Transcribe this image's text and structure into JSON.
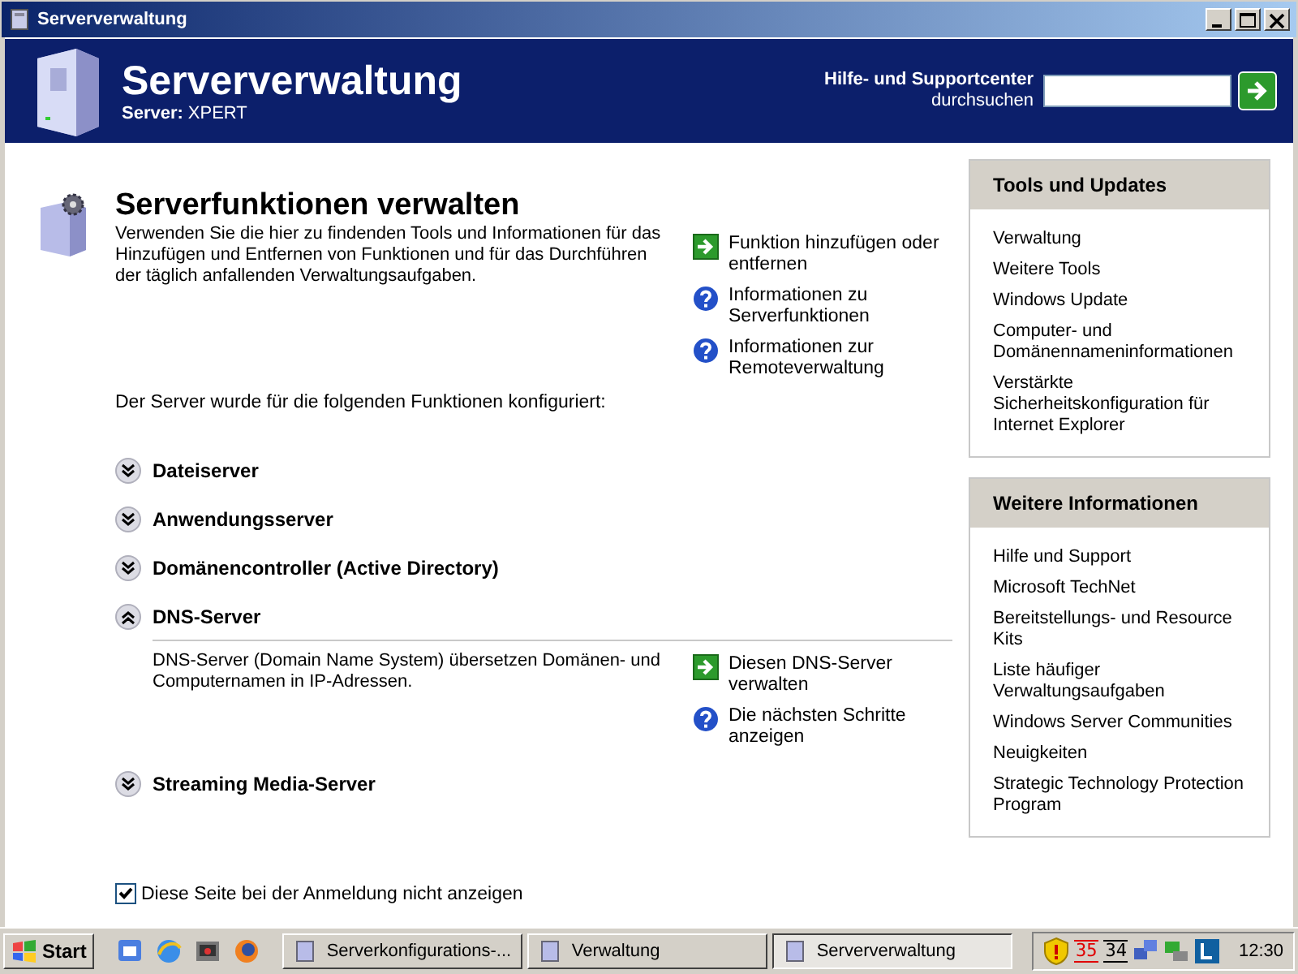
{
  "window": {
    "title": "Serververwaltung"
  },
  "header": {
    "title": "Serververwaltung",
    "server_label": "Server:",
    "server_name": "XPERT",
    "search_label": "Hilfe- und Supportcenter",
    "search_sub": "durchsuchen"
  },
  "intro": {
    "title": "Serverfunktionen verwalten",
    "description": "Verwenden Sie die hier zu findenden Tools und Informationen für das Hinzufügen und Entfernen von Funktionen und für das Durchführen der täglich anfallenden Verwaltungsaufgaben.",
    "links": [
      {
        "kind": "arrow",
        "label": "Funktion hinzufügen oder entfernen"
      },
      {
        "kind": "help",
        "label": "Informationen zu Serverfunktionen"
      },
      {
        "kind": "help",
        "label": "Informationen zur Remoteverwaltung"
      }
    ],
    "configured_text": "Der Server wurde für die folgenden Funktionen konfiguriert:"
  },
  "roles": [
    {
      "name": "Dateiserver",
      "expanded": false
    },
    {
      "name": "Anwendungsserver",
      "expanded": false
    },
    {
      "name": "Domänencontroller (Active Directory)",
      "expanded": false
    },
    {
      "name": "DNS-Server",
      "expanded": true,
      "description": "DNS-Server (Domain Name System) übersetzen Domänen- und Computernamen in IP-Adressen.",
      "links": [
        {
          "kind": "arrow",
          "label": "Diesen DNS-Server verwalten"
        },
        {
          "kind": "help",
          "label": "Die nächsten Schritte anzeigen"
        }
      ]
    },
    {
      "name": "Streaming Media-Server",
      "expanded": false
    }
  ],
  "hide_option": {
    "label": "Diese Seite bei der Anmeldung nicht anzeigen",
    "checked": true
  },
  "sidebar": [
    {
      "title": "Tools und Updates",
      "items": [
        "Verwaltung",
        "Weitere Tools",
        "Windows Update",
        "Computer- und Domänennameninformationen",
        "Verstärkte Sicherheitskonfiguration für Internet Explorer"
      ]
    },
    {
      "title": "Weitere Informationen",
      "items": [
        "Hilfe und Support",
        "Microsoft TechNet",
        "Bereitstellungs- und Resource Kits",
        "Liste häufiger Verwaltungsaufgaben",
        "Windows Server Communities",
        "Neuigkeiten",
        "Strategic Technology Protection Program"
      ]
    }
  ],
  "taskbar": {
    "start": "Start",
    "tasks": [
      {
        "label": "Serverkonfigurations-...",
        "selected": false
      },
      {
        "label": "Verwaltung",
        "selected": false
      },
      {
        "label": "Serververwaltung",
        "selected": true
      }
    ],
    "tray_numbers": [
      {
        "text": "35",
        "color": "#e00000"
      },
      {
        "text": "34",
        "color": "#000000"
      }
    ],
    "clock": "12:30"
  }
}
